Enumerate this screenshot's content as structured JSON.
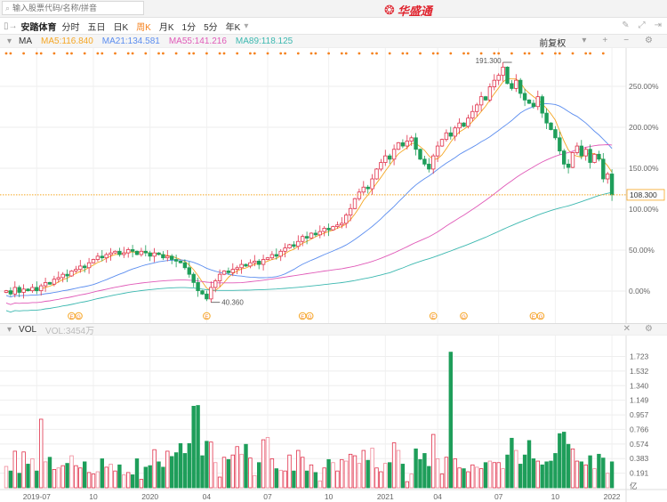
{
  "search": {
    "placeholder": "输入股票代码/名称/拼音"
  },
  "brand": {
    "name": "华盛通"
  },
  "toolbar": {
    "stock_name": "安踏体育",
    "periods": [
      "分时",
      "五日",
      "日K",
      "周K",
      "月K",
      "1分",
      "5分",
      "年K"
    ],
    "active_period": "周K",
    "more": "▾"
  },
  "ma_legend": {
    "label": "MA",
    "ma5": "MA5:116.840",
    "ma21": "MA21:134.581",
    "ma55": "MA55:141.216",
    "ma89": "MA89:118.125",
    "adjust": "前复权"
  },
  "vol_legend": {
    "label": "VOL",
    "value": "VOL:3454万"
  },
  "colors": {
    "up": "#e0304a",
    "down": "#1e9e5a",
    "ma5": "#f5a623",
    "ma21": "#5b8def",
    "ma55": "#e05ab8",
    "ma89": "#3cb8b0",
    "accent": "#f5821f"
  },
  "chart_data": {
    "type": "candlestick",
    "price_axis": {
      "labels": [
        "250.00%",
        "200.00%",
        "150.00%",
        "100.00%",
        "50.00%",
        "0.00%"
      ],
      "values": [
        250,
        200,
        150,
        100,
        50,
        0
      ]
    },
    "base_price": 49.8,
    "current_price": "108.300",
    "high_label": "191.300",
    "low_label": "40.360",
    "x_ticks": [
      "2019-07",
      "10",
      "2020",
      "04",
      "07",
      "10",
      "2021",
      "04",
      "07",
      "10",
      "2022"
    ],
    "x_tick_bar_index": [
      7,
      20,
      33,
      46,
      60,
      74,
      87,
      99,
      113,
      126,
      139
    ],
    "close": [
      50,
      48,
      52,
      49,
      51,
      50,
      52,
      50,
      53,
      55,
      54,
      57,
      58,
      60,
      59,
      62,
      63,
      65,
      64,
      67,
      69,
      71,
      70,
      72,
      73,
      74,
      72,
      73,
      75,
      74,
      72,
      74,
      73,
      71,
      73,
      72,
      70,
      71,
      69,
      68,
      67,
      64,
      60,
      55,
      50,
      48,
      45,
      52,
      56,
      60,
      62,
      61,
      63,
      64,
      66,
      65,
      67,
      68,
      66,
      69,
      70,
      72,
      71,
      74,
      76,
      78,
      77,
      80,
      83,
      82,
      85,
      84,
      86,
      88,
      87,
      89,
      90,
      91,
      96,
      100,
      106,
      110,
      113,
      112,
      118,
      124,
      128,
      132,
      130,
      136,
      140,
      138,
      141,
      143,
      136,
      130,
      127,
      124,
      132,
      138,
      142,
      146,
      144,
      149,
      152,
      150,
      155,
      159,
      163,
      168,
      166,
      174,
      178,
      181,
      186,
      176,
      173,
      178,
      170,
      166,
      164,
      162,
      168,
      158,
      152,
      148,
      143,
      135,
      127,
      125,
      134,
      138,
      132,
      136,
      128,
      133,
      130,
      118,
      121,
      108.3
    ],
    "volume_axis": {
      "labels": [
        "1.723",
        "1.532",
        "1.340",
        "1.149",
        "0.957",
        "0.766",
        "0.574",
        "0.383",
        "0.191",
        "亿"
      ],
      "values": [
        1.723,
        1.532,
        1.34,
        1.149,
        0.957,
        0.766,
        0.574,
        0.383,
        0.191
      ]
    },
    "volume": [
      0.28,
      0.22,
      0.48,
      0.19,
      0.47,
      0.31,
      0.38,
      0.22,
      0.9,
      0.34,
      0.4,
      0.24,
      0.26,
      0.29,
      0.32,
      0.42,
      0.29,
      0.26,
      0.34,
      0.2,
      0.18,
      0.21,
      0.38,
      0.27,
      0.31,
      0.22,
      0.3,
      0.17,
      0.2,
      0.17,
      0.38,
      0.11,
      0.27,
      0.29,
      0.5,
      0.34,
      0.27,
      0.48,
      0.41,
      0.46,
      0.58,
      0.45,
      0.58,
      1.07,
      1.08,
      0.42,
      0.61,
      0.6,
      0.33,
      0.14,
      0.4,
      0.37,
      0.43,
      0.54,
      0.44,
      0.57,
      0.39,
      0.16,
      0.33,
      0.63,
      0.66,
      0.38,
      0.25,
      0.23,
      0.22,
      0.43,
      0.22,
      0.49,
      0.4,
      0.22,
      0.3,
      0.2,
      0.09,
      0.26,
      0.37,
      0.33,
      0.22,
      0.37,
      0.35,
      0.44,
      0.42,
      0.32,
      0.49,
      0.36,
      0.52,
      0.26,
      0.21,
      0.32,
      0.33,
      0.59,
      0.49,
      0.31,
      0.08,
      0.18,
      0.51,
      0.37,
      0.45,
      0.28,
      0.7,
      0.38,
      0.18,
      0.4,
      1.78,
      0.38,
      0.26,
      0.25,
      0.21,
      0.3,
      0.27,
      0.25,
      0.33,
      0.35,
      0.33,
      0.33,
      0.25,
      0.43,
      0.65,
      0.49,
      0.31,
      0.43,
      0.62,
      0.38,
      0.35,
      0.3,
      0.34,
      0.35,
      0.45,
      0.71,
      0.73,
      0.57,
      0.51,
      0.35,
      0.34,
      0.3,
      0.42,
      0.25,
      0.44,
      0.39,
      0.19,
      0.34
    ],
    "event_markers": [
      {
        "bar": 15,
        "labels": [
          "E",
          "G"
        ]
      },
      {
        "bar": 46,
        "labels": [
          "E"
        ]
      },
      {
        "bar": 68,
        "labels": [
          "E",
          "G"
        ]
      },
      {
        "bar": 98,
        "labels": [
          "E"
        ]
      },
      {
        "bar": 105,
        "labels": [
          "G"
        ]
      },
      {
        "bar": 121,
        "labels": [
          "E",
          "G"
        ]
      }
    ]
  }
}
